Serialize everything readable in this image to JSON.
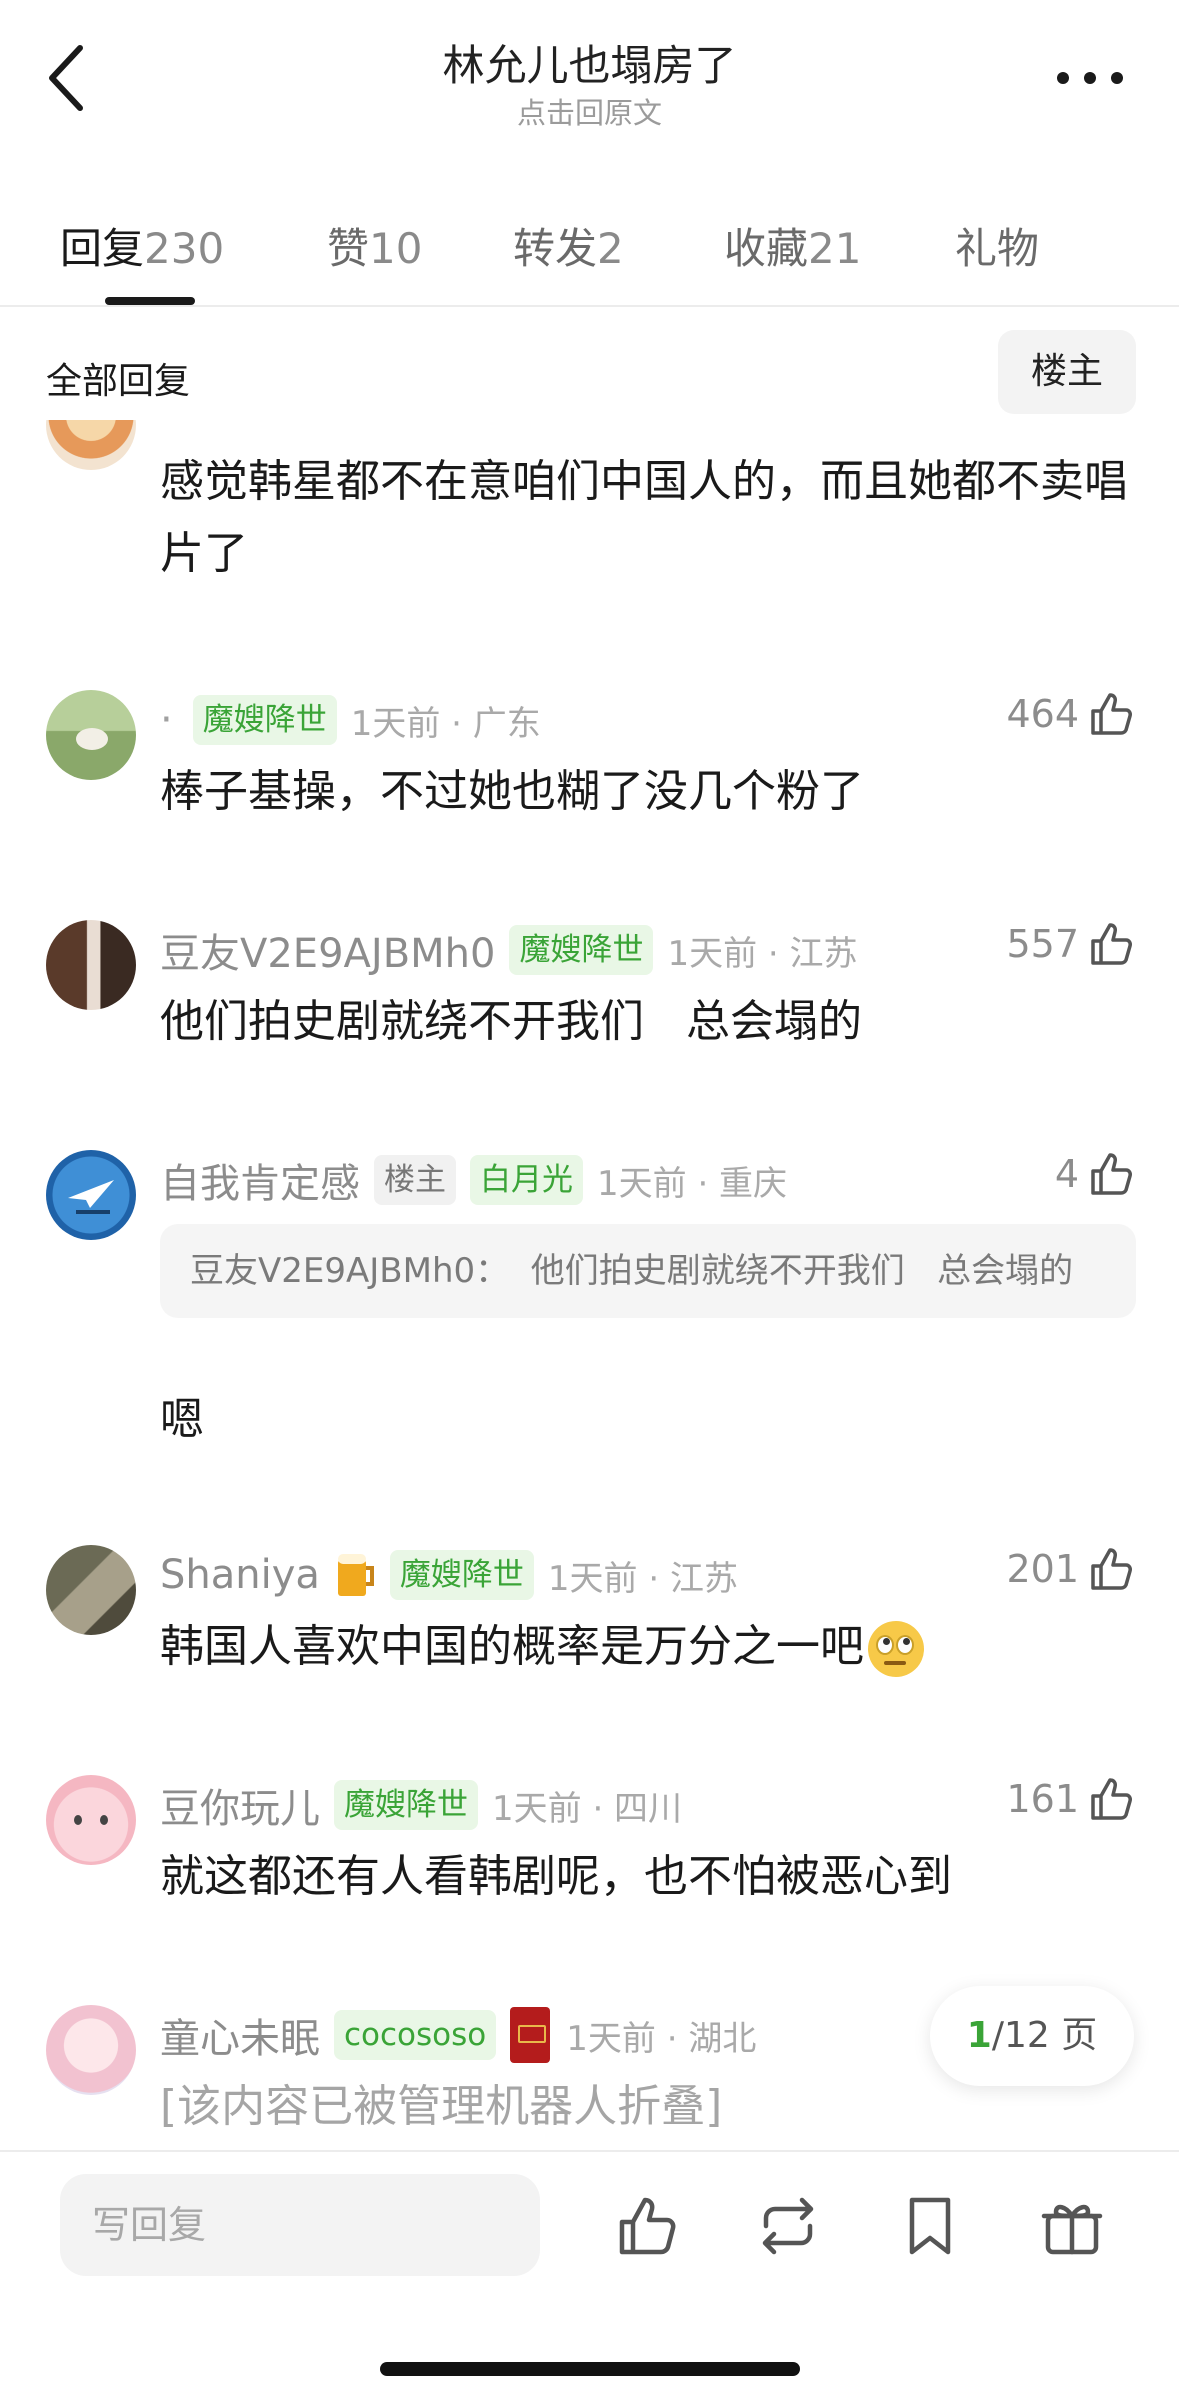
{
  "header": {
    "title": "林允儿也塌房了",
    "subtitle": "点击回原文"
  },
  "tabs": [
    {
      "label": "回复",
      "count": "230",
      "active": true
    },
    {
      "label": "赞",
      "count": "10",
      "active": false
    },
    {
      "label": "转发",
      "count": "2",
      "active": false
    },
    {
      "label": "收藏",
      "count": "21",
      "active": false
    },
    {
      "label": "礼物",
      "count": "",
      "active": false
    }
  ],
  "filter": {
    "title": "全部回复",
    "op_toggle": "楼主"
  },
  "comments": [
    {
      "text": "感觉韩星都不在意咱们中国人的，而且她都不卖唱片了"
    },
    {
      "prefix": "·",
      "badge": "魔嫂降世",
      "time_loc": "1天前 · 广东",
      "likes": "464",
      "text": "棒子基操，不过她也糊了没几个粉了"
    },
    {
      "username": "豆友V2E9AJBMh0",
      "badge": "魔嫂降世",
      "time_loc": "1天前 · 江苏",
      "likes": "557",
      "text": "他们拍史剧就绕不开我们   总会塌的"
    },
    {
      "username": "自我肯定感",
      "op_badge": "楼主",
      "badge": "白月光",
      "time_loc": "1天前 · 重庆",
      "likes": "4",
      "quote": "豆友V2E9AJBMh0：  他们拍史剧就绕不开我们   总会塌的",
      "text": "嗯"
    },
    {
      "username": "Shaniya",
      "badge": "魔嫂降世",
      "time_loc": "1天前 · 江苏",
      "likes": "201",
      "text": "韩国人喜欢中国的概率是万分之一吧"
    },
    {
      "username": "豆你玩儿",
      "badge": "魔嫂降世",
      "time_loc": "1天前 · 四川",
      "likes": "161",
      "text": "就这都还有人看韩剧呢，也不怕被恶心到"
    },
    {
      "username": "童心未眠",
      "badge": "cocososo",
      "time_loc": "1天前 · 湖北",
      "text": "[该内容已被管理机器人折叠]"
    }
  ],
  "pagination": {
    "current": "1",
    "total": "/12 页"
  },
  "bottom_bar": {
    "reply_placeholder": "写回复"
  },
  "colors": {
    "accent_green": "#3aa437",
    "badge_green_bg": "#e9f7e6",
    "text_primary": "#1a1a1a",
    "text_secondary": "#8c8c8c"
  },
  "icons": [
    "back-arrow-icon",
    "more-dots-icon",
    "thumbs-up-icon",
    "repost-icon",
    "bookmark-icon",
    "gift-icon",
    "beer-icon",
    "rolling-eyes-emoji-icon"
  ]
}
